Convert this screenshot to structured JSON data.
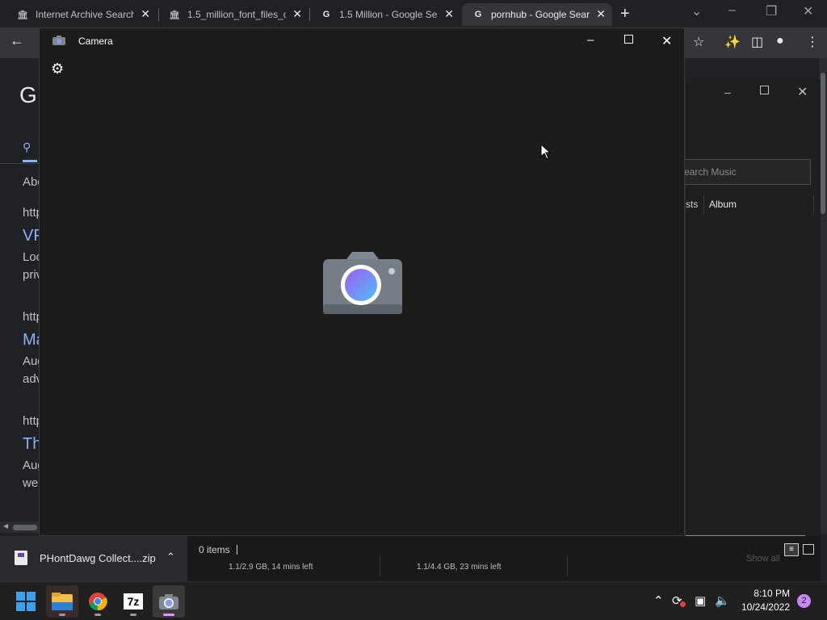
{
  "browser": {
    "tabs": [
      {
        "title": "Internet Archive Search",
        "icon": "archive-icon"
      },
      {
        "title": "1.5_million_font_files_co",
        "icon": "archive-icon"
      },
      {
        "title": "1.5 Million - Google Se",
        "icon": "google-icon"
      },
      {
        "title": "pornhub - Google Sear",
        "icon": "google-icon"
      }
    ],
    "new_tab": "+",
    "window_controls": [
      "minimize",
      "restore",
      "close"
    ]
  },
  "google_page": {
    "logo_letter": "G",
    "about_fragment": "Abo",
    "results": [
      {
        "url": "http",
        "title": "VP",
        "snippet_1": "Loc",
        "snippet_2": "priv"
      },
      {
        "url": "http",
        "title": "Ma",
        "snippet_1": "Aug",
        "snippet_2": "adv"
      },
      {
        "url": "http",
        "title": "Th",
        "snippet_1": "Aug",
        "snippet_2": "wel"
      }
    ]
  },
  "music_app": {
    "search_placeholder": "earch Music",
    "columns": [
      "sts",
      "Album"
    ]
  },
  "camera_app": {
    "title": "Camera",
    "settings_icon": "gear-icon"
  },
  "explorer": {
    "items_count": "0 items",
    "downloads": [
      {
        "progress": "1.1/2.9 GB, 14 mins left"
      },
      {
        "progress": "1.1/4.4 GB, 23 mins left"
      }
    ],
    "show_all": "Show all"
  },
  "download_shelf": {
    "file_name": "PHontDawg Collect....zip"
  },
  "taskbar": {
    "apps": [
      "windows-start",
      "file-explorer",
      "chrome",
      "7zip",
      "camera"
    ],
    "clock_time": "8:10 PM",
    "clock_date": "10/24/2022",
    "notification_count": "2",
    "seven_zip_label": "7z"
  }
}
